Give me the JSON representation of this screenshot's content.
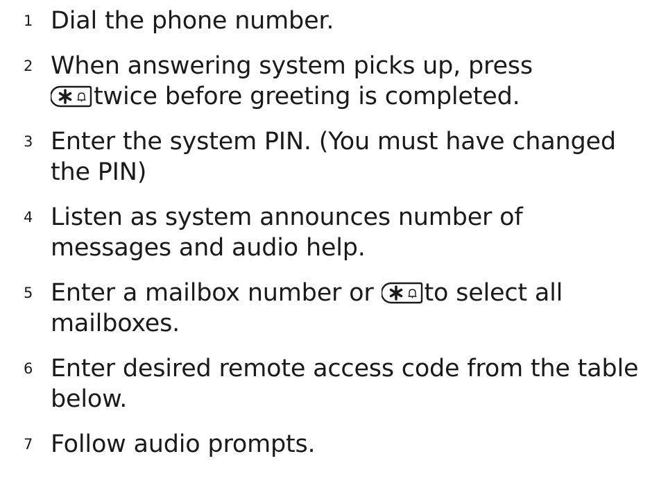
{
  "steps": [
    {
      "number": "1",
      "lines": [
        "Dial the phone number."
      ]
    },
    {
      "number": "2",
      "lines": [
        "When answering system picks up, press",
        "twice before greeting is completed."
      ]
    },
    {
      "number": "3",
      "lines": [
        "Enter the system PIN. (You must have changed",
        "the PIN)"
      ]
    },
    {
      "number": "4",
      "lines": [
        "Listen as system announces number of",
        "messages and audio help."
      ]
    },
    {
      "number": "5",
      "lines": [
        "Enter a mailbox number or",
        "to select all",
        "mailboxes."
      ]
    },
    {
      "number": "6",
      "lines": [
        "Enter desired remote access code from the table",
        "below."
      ]
    },
    {
      "number": "7",
      "lines": [
        "Follow audio prompts."
      ]
    }
  ],
  "icons": {
    "star_key": "star-bell-key-icon"
  }
}
